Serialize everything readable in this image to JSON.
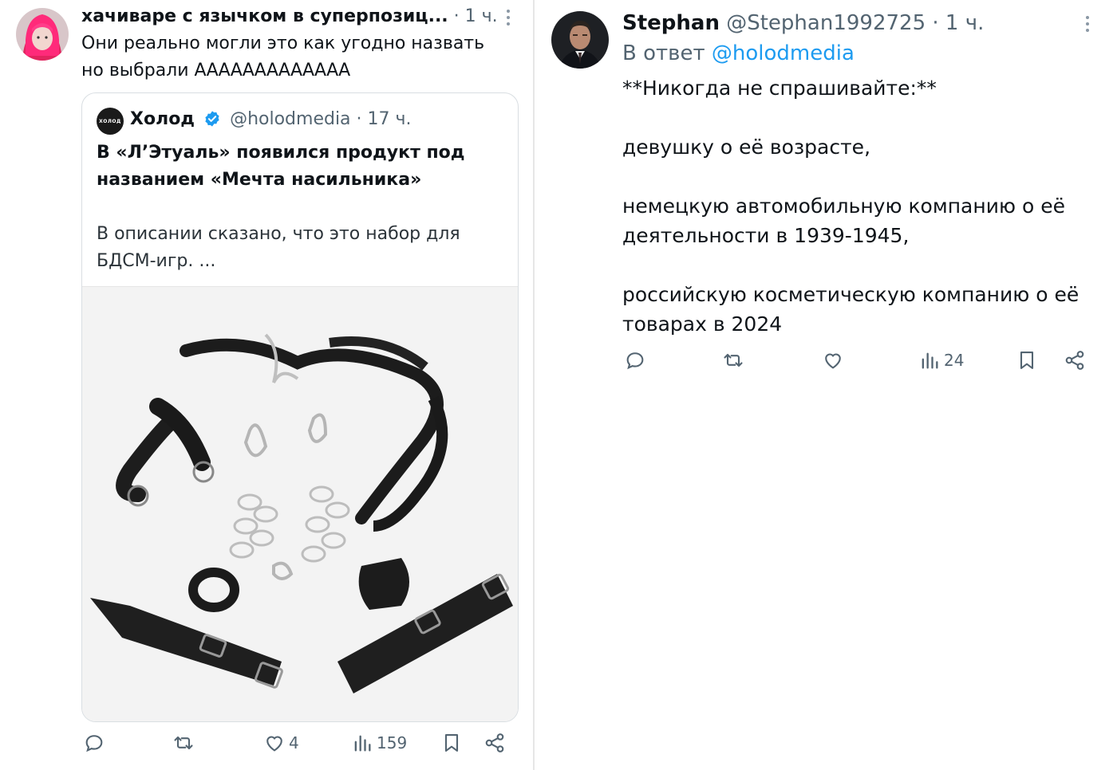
{
  "left_tweet": {
    "author_name": "хачиваре с язычком в суперпозиц...",
    "time": "· 1 ч.",
    "text_line1": "Они реально могли это как угодно назвать",
    "text_line2": "но выбрали ААААААААААААА",
    "quote": {
      "logo_text": "ХОЛОД",
      "author_name": "Холод",
      "handle": "@holodmedia",
      "time": "· 17 ч.",
      "headline_line1": "В «Л’Этуаль» появился продукт под",
      "headline_line2": "названием «Мечта насильника»",
      "desc_line1": "В описании сказано, что это набор для",
      "desc_line2": "БДСМ-игр. ..."
    },
    "actions": {
      "reply_icon": "reply-icon",
      "retweet_icon": "retweet-icon",
      "like_icon": "heart-icon",
      "like_count": "4",
      "views_icon": "views-icon",
      "views_count": "159",
      "bookmark_icon": "bookmark-icon",
      "share_icon": "share-icon"
    }
  },
  "right_tweet": {
    "author_name": "Stephan",
    "handle": "@Stephan1992725",
    "time": "· 1 ч.",
    "reply_prefix": "В ответ",
    "reply_to": "@holodmedia",
    "line1": "**Никогда не спрашивайте:**",
    "line2": "девушку о её возрасте,",
    "line3a": "немецкую автомобильную компанию о её",
    "line3b": "деятельности в 1939-1945,",
    "line4a": "российскую косметическую компанию о её",
    "line4b": "товарах в 2024",
    "actions": {
      "views_count": "24"
    }
  },
  "colors": {
    "text": "#0f1419",
    "muted": "#536471",
    "link": "#1d9bf0",
    "verified": "#1d9bf0"
  }
}
